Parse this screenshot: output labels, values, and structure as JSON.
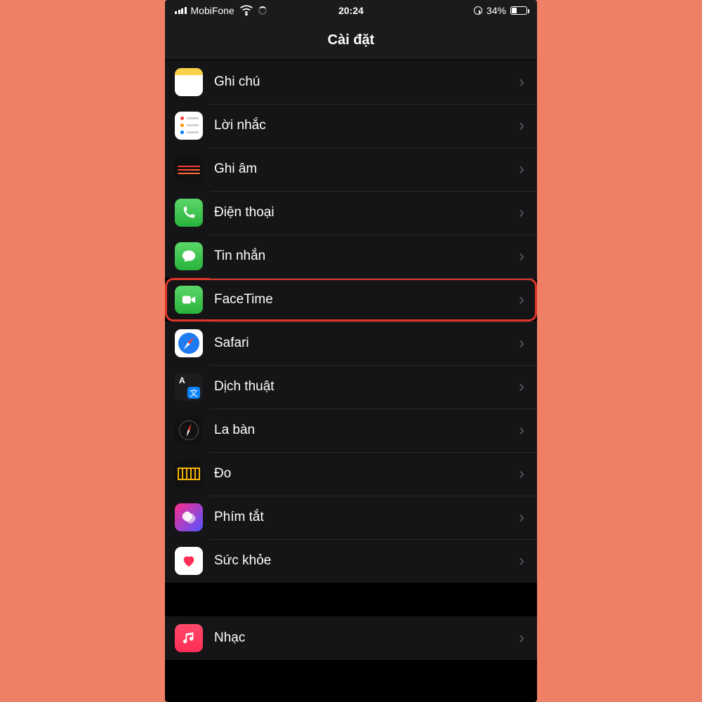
{
  "statusbar": {
    "carrier": "MobiFone",
    "time": "20:24",
    "battery_text": "34%"
  },
  "header": {
    "title": "Cài đặt"
  },
  "rows": {
    "notes": "Ghi chú",
    "reminders": "Lời nhắc",
    "voice": "Ghi âm",
    "phone": "Điện thoại",
    "messages": "Tin nhắn",
    "facetime": "FaceTime",
    "safari": "Safari",
    "translate": "Dịch thuật",
    "compass": "La bàn",
    "measure": "Đo",
    "shortcuts": "Phím tắt",
    "health": "Sức khỏe",
    "music": "Nhạc"
  }
}
